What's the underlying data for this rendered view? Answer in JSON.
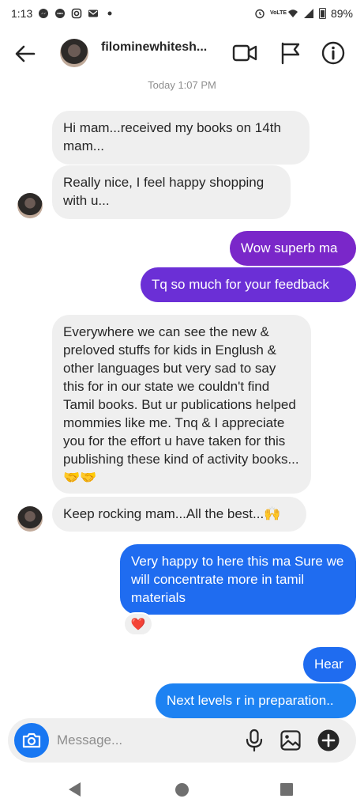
{
  "status_bar": {
    "time": "1:13",
    "battery": "89%",
    "network_label": "VoLTE",
    "icons": [
      "messenger-icon",
      "chat-icon",
      "instagram-icon",
      "gmail-icon",
      "dot-icon",
      "alarm-icon",
      "volte-icon",
      "wifi-icon",
      "signal-icon",
      "battery-icon"
    ]
  },
  "header": {
    "username": "filominewhitesh...",
    "icons": [
      "back-arrow-icon",
      "video-call-icon",
      "flag-icon",
      "info-icon"
    ]
  },
  "timestamp": "Today 1:07 PM",
  "messages": [
    {
      "side": "in",
      "text": "Hi mam...received my books on 14th mam..."
    },
    {
      "side": "in",
      "text": "Really nice, I feel happy shopping with u..."
    },
    {
      "side": "out",
      "text": "Wow superb ma"
    },
    {
      "side": "out",
      "text": "Tq so much for your feedback"
    },
    {
      "side": "in",
      "text": "Everywhere we can see the new & preloved stuffs for kids in Englush & other languages but very sad to say this for in our state we couldn't find Tamil books. But ur publications helped mommies like me. Tnq & I appreciate you for the effort u have taken for this publishing these kind of activity books...🤝🤝"
    },
    {
      "side": "in",
      "text": "Keep rocking mam...All the best...🙌"
    },
    {
      "side": "out",
      "text": "Very happy to here this ma Sure we will concentrate more in tamil materials"
    },
    {
      "side": "out",
      "text": "Hear"
    },
    {
      "side": "out",
      "text": "Next levels r in preparation.."
    }
  ],
  "reaction": {
    "emoji": "❤️"
  },
  "composer": {
    "placeholder": "Message...",
    "icons": [
      "camera-icon",
      "microphone-icon",
      "gallery-icon",
      "plus-icon"
    ]
  },
  "colors": {
    "incoming_bubble": "#efefef",
    "outgoing_purple": "#7a27c9",
    "outgoing_blue": "#1f6cf0",
    "camera_blue": "#1877f2"
  }
}
